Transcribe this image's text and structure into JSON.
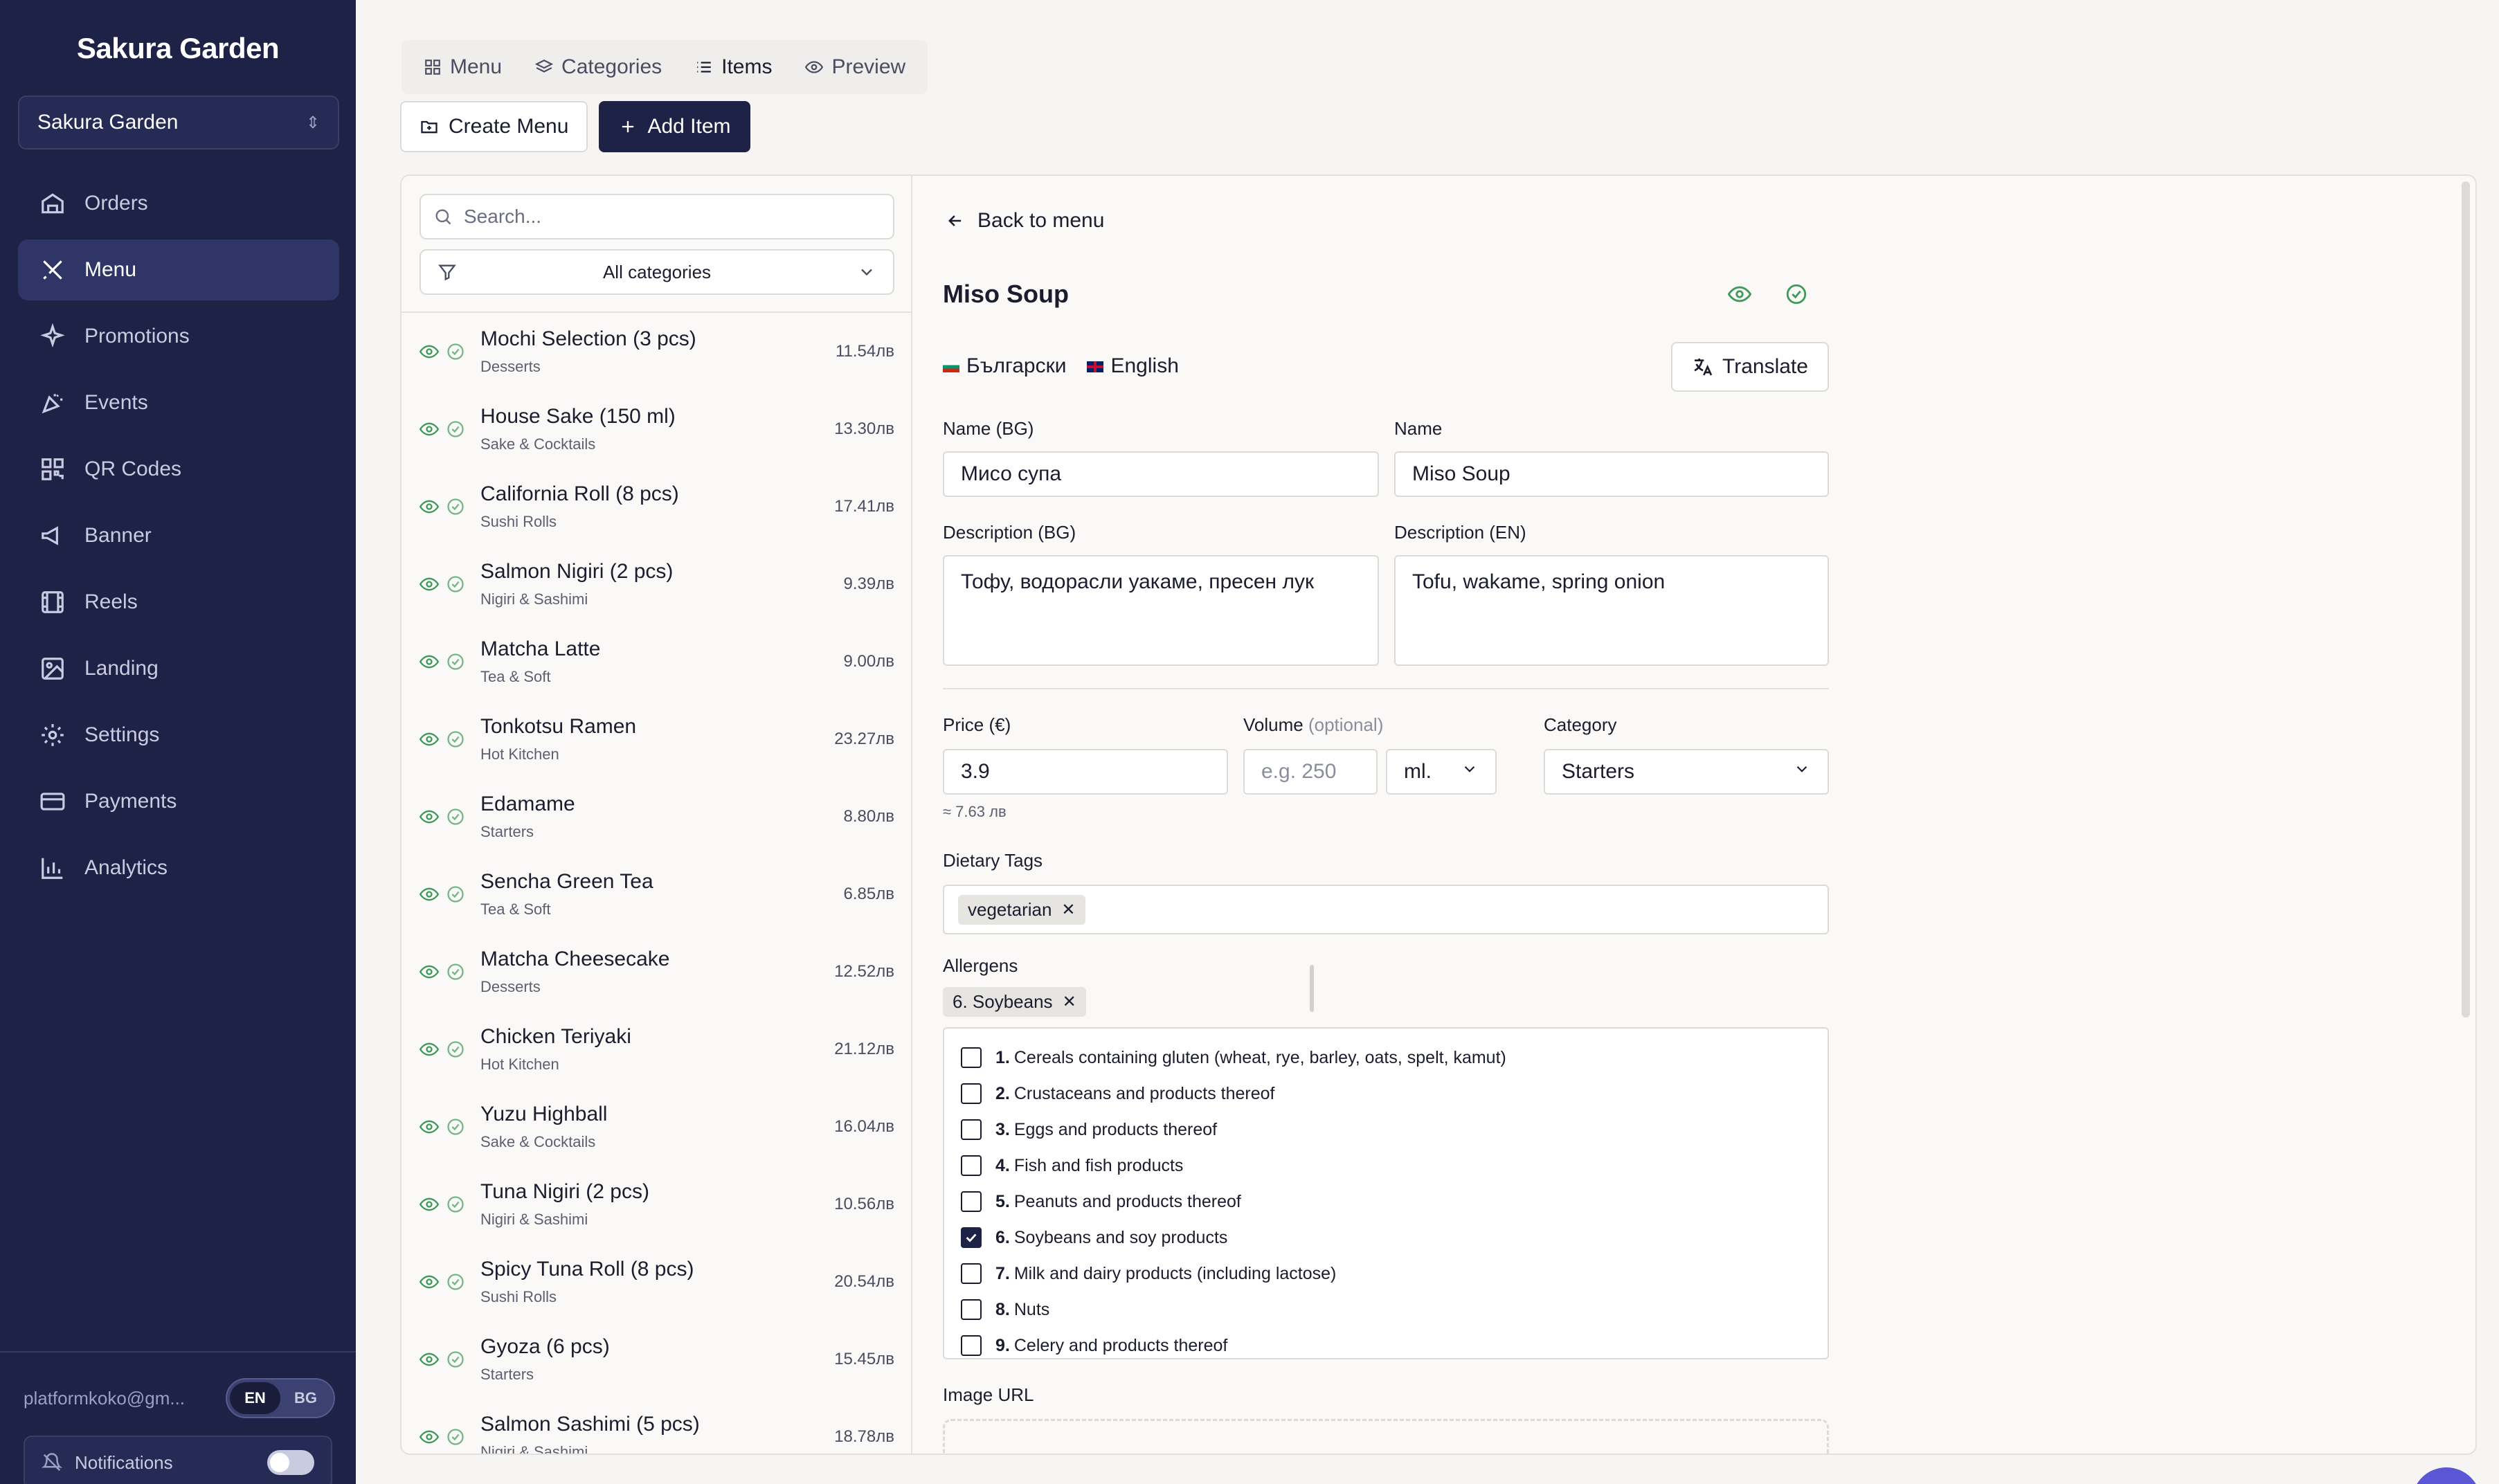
{
  "brand": "Sakura Garden",
  "restaurant_select": {
    "value": "Sakura Garden"
  },
  "nav": [
    {
      "label": "Orders",
      "icon": "orders-icon"
    },
    {
      "label": "Menu",
      "icon": "menu-icon",
      "active": true
    },
    {
      "label": "Promotions",
      "icon": "sparkles-icon"
    },
    {
      "label": "Events",
      "icon": "party-icon"
    },
    {
      "label": "QR Codes",
      "icon": "qr-icon"
    },
    {
      "label": "Banner",
      "icon": "megaphone-icon"
    },
    {
      "label": "Reels",
      "icon": "film-icon"
    },
    {
      "label": "Landing",
      "icon": "image-icon"
    },
    {
      "label": "Settings",
      "icon": "gear-icon"
    },
    {
      "label": "Payments",
      "icon": "card-icon"
    },
    {
      "label": "Analytics",
      "icon": "chart-icon"
    }
  ],
  "user": {
    "email": "platformkoko@gm...",
    "lang_en": "EN",
    "lang_bg": "BG"
  },
  "notifications": {
    "label": "Notifications"
  },
  "tabs": [
    {
      "label": "Menu"
    },
    {
      "label": "Categories"
    },
    {
      "label": "Items",
      "active": true
    },
    {
      "label": "Preview"
    }
  ],
  "toolbar": {
    "create_menu": "Create Menu",
    "add_item": "Add Item"
  },
  "search": {
    "placeholder": "Search..."
  },
  "category_filter": {
    "value": "All categories"
  },
  "items": [
    {
      "name": "Mochi Selection (3 pcs)",
      "category": "Desserts",
      "price": "11.54лв"
    },
    {
      "name": "House Sake (150 ml)",
      "category": "Sake & Cocktails",
      "price": "13.30лв"
    },
    {
      "name": "California Roll (8 pcs)",
      "category": "Sushi Rolls",
      "price": "17.41лв"
    },
    {
      "name": "Salmon Nigiri (2 pcs)",
      "category": "Nigiri & Sashimi",
      "price": "9.39лв"
    },
    {
      "name": "Matcha Latte",
      "category": "Tea & Soft",
      "price": "9.00лв"
    },
    {
      "name": "Tonkotsu Ramen",
      "category": "Hot Kitchen",
      "price": "23.27лв"
    },
    {
      "name": "Edamame",
      "category": "Starters",
      "price": "8.80лв"
    },
    {
      "name": "Sencha Green Tea",
      "category": "Tea & Soft",
      "price": "6.85лв"
    },
    {
      "name": "Matcha Cheesecake",
      "category": "Desserts",
      "price": "12.52лв"
    },
    {
      "name": "Chicken Teriyaki",
      "category": "Hot Kitchen",
      "price": "21.12лв"
    },
    {
      "name": "Yuzu Highball",
      "category": "Sake & Cocktails",
      "price": "16.04лв"
    },
    {
      "name": "Tuna Nigiri (2 pcs)",
      "category": "Nigiri & Sashimi",
      "price": "10.56лв"
    },
    {
      "name": "Spicy Tuna Roll (8 pcs)",
      "category": "Sushi Rolls",
      "price": "20.54лв"
    },
    {
      "name": "Gyoza (6 pcs)",
      "category": "Starters",
      "price": "15.45лв"
    },
    {
      "name": "Salmon Sashimi (5 pcs)",
      "category": "Nigiri & Sashimi",
      "price": "18.78лв"
    }
  ],
  "detail": {
    "back": "Back to menu",
    "title": "Miso Soup",
    "lang_bg": "Български",
    "lang_en": "English",
    "translate": "Translate",
    "name_bg_label": "Name (BG)",
    "name_bg": "Мисо супа",
    "name_label": "Name",
    "name_en": "Miso Soup",
    "desc_bg_label": "Description (BG)",
    "desc_bg": "Тофу, водорасли уакаме, пресен лук",
    "desc_en_label": "Description (EN)",
    "desc_en": "Tofu, wakame, spring onion",
    "price_label": "Price (€)",
    "price": "3.9",
    "price_hint": "≈ 7.63 лв",
    "volume_label": "Volume",
    "volume_optional": "(optional)",
    "volume_placeholder": "e.g. 250",
    "volume_unit": "ml.",
    "category_label": "Category",
    "category": "Starters",
    "dietary_label": "Dietary Tags",
    "dietary_tags": [
      "vegetarian"
    ],
    "allergens_label": "Allergens",
    "allergen_selected": "6. Soybeans",
    "allergens": [
      {
        "num": "1.",
        "text": "Cereals containing gluten (wheat, rye, barley, oats, spelt, kamut)",
        "checked": false
      },
      {
        "num": "2.",
        "text": "Crustaceans and products thereof",
        "checked": false
      },
      {
        "num": "3.",
        "text": "Eggs and products thereof",
        "checked": false
      },
      {
        "num": "4.",
        "text": "Fish and fish products",
        "checked": false
      },
      {
        "num": "5.",
        "text": "Peanuts and products thereof",
        "checked": false
      },
      {
        "num": "6.",
        "text": "Soybeans and soy products",
        "checked": true
      },
      {
        "num": "7.",
        "text": "Milk and dairy products (including lactose)",
        "checked": false
      },
      {
        "num": "8.",
        "text": "Nuts",
        "checked": false
      },
      {
        "num": "9.",
        "text": "Celery and products thereof",
        "checked": false
      }
    ],
    "image_url_label": "Image URL"
  },
  "colors": {
    "sidebar": "#1e2246",
    "accent_green": "#3f9a5a",
    "primary": "#1e2246"
  }
}
